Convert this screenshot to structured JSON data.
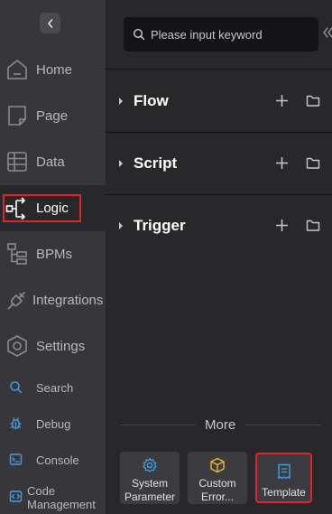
{
  "nav": {
    "collapse_icon": "chevron-left-icon",
    "items": [
      {
        "label": "Home",
        "icon": "home-icon"
      },
      {
        "label": "Page",
        "icon": "page-icon"
      },
      {
        "label": "Data",
        "icon": "table-icon"
      },
      {
        "label": "Logic",
        "icon": "logic-flow-icon",
        "active": true
      },
      {
        "label": "BPMs",
        "icon": "bpm-tree-icon"
      },
      {
        "label": "Integrations",
        "icon": "plug-icon"
      },
      {
        "label": "Settings",
        "icon": "hexagon-gear-icon"
      }
    ],
    "tools": [
      {
        "label": "Search",
        "icon": "search-icon"
      },
      {
        "label": "Debug",
        "icon": "bug-icon"
      },
      {
        "label": "Console",
        "icon": "terminal-icon"
      },
      {
        "label_line1": "Code",
        "label_line2": "Management",
        "icon": "code-icon"
      }
    ]
  },
  "panel": {
    "search": {
      "placeholder": "Please input keyword",
      "value": ""
    },
    "sections": [
      {
        "title": "Flow"
      },
      {
        "title": "Script"
      },
      {
        "title": "Trigger"
      }
    ],
    "more_label": "More",
    "cards": [
      {
        "line1": "System",
        "line2": "Parameter",
        "icon": "gear-icon"
      },
      {
        "line1": "Custom",
        "line2": "Error...",
        "icon": "cube-icon"
      },
      {
        "line1": "",
        "line2": "Template",
        "icon": "receipt-icon"
      }
    ]
  },
  "colors": {
    "accent": "#3ea0e6",
    "highlight": "#e0242b",
    "nav_bg": "#37373b",
    "panel_bg": "#28282b"
  }
}
